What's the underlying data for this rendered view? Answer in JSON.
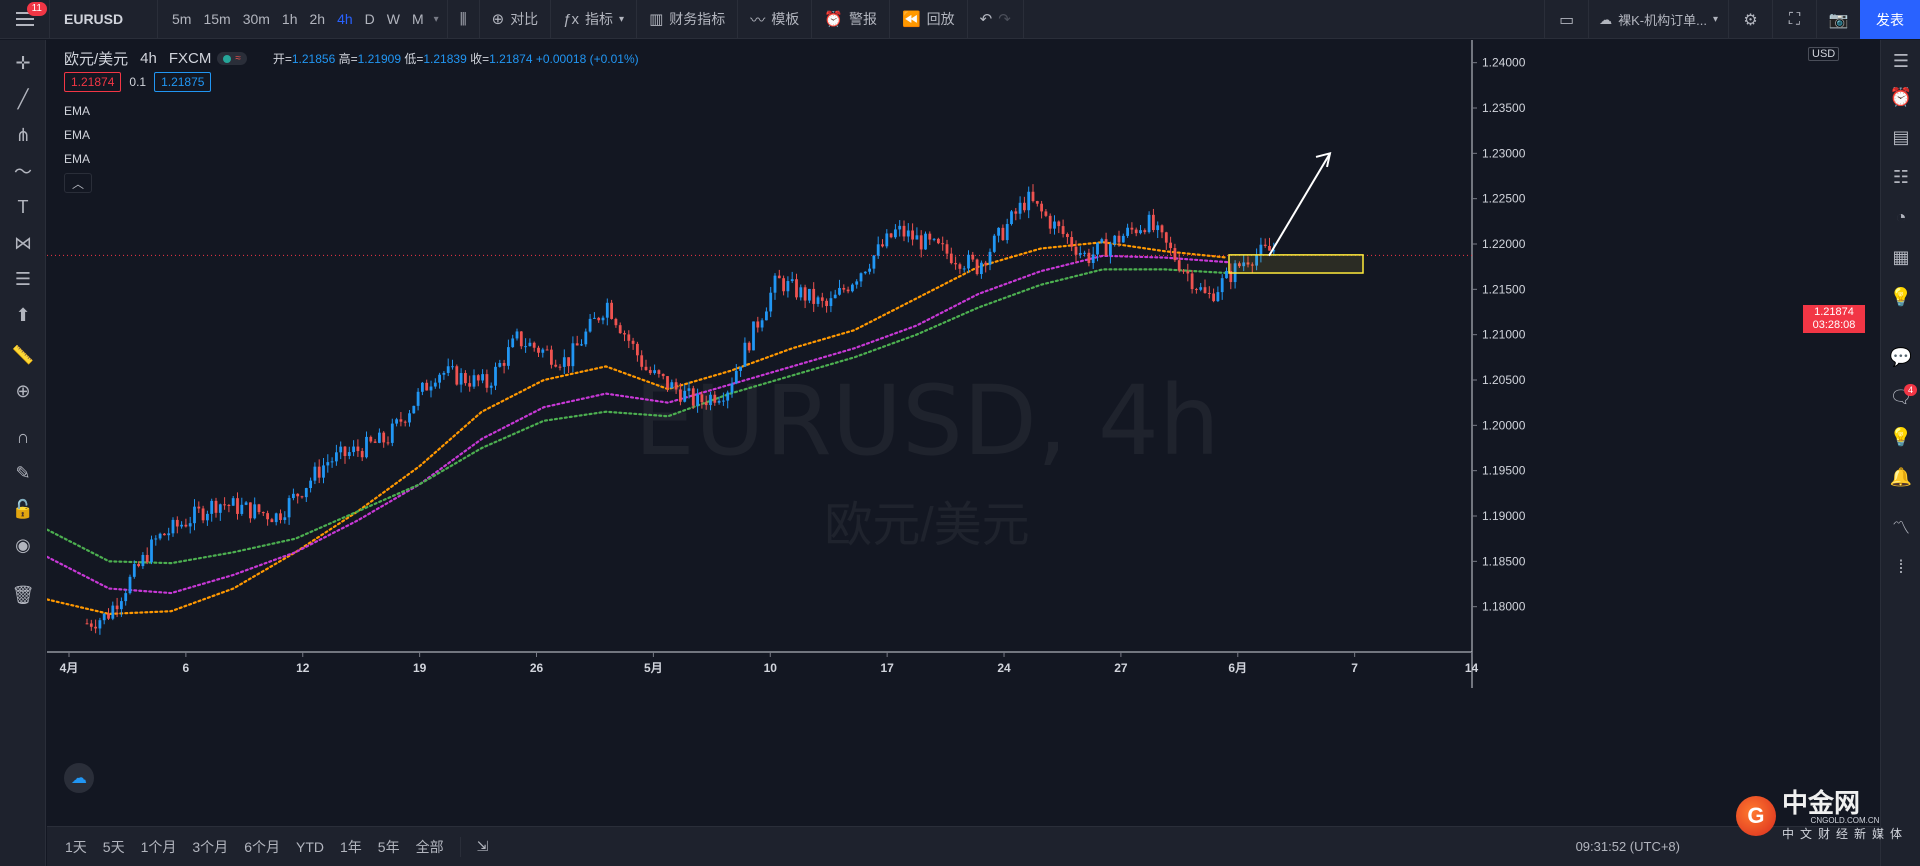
{
  "toolbar": {
    "menu_badge": "11",
    "symbol": "EURUSD",
    "intervals": [
      "5m",
      "15m",
      "30m",
      "1h",
      "2h",
      "4h",
      "D",
      "W",
      "M"
    ],
    "active_interval": "4h",
    "compare": "对比",
    "indicators": "指标",
    "financials": "财务指标",
    "templates": "模板",
    "alert": "警报",
    "replay": "回放",
    "layout_name": "裸K-机构订单...",
    "publish": "发表"
  },
  "legend": {
    "symbol": "欧元/美元",
    "interval": "4h",
    "source": "FXCM",
    "open_label": "开=",
    "open": "1.21856",
    "high_label": "高=",
    "high": "1.21909",
    "low_label": "低=",
    "low": "1.21839",
    "close_label": "收=",
    "close": "1.21874",
    "change": "+0.00018 (+0.01%)",
    "sell": "1.21874",
    "spread": "0.1",
    "buy": "1.21875",
    "indicators": [
      "EMA",
      "EMA",
      "EMA"
    ]
  },
  "watermark": {
    "line1": "EURUSD, 4h",
    "line2": "欧元/美元"
  },
  "price_scale": {
    "currency": "USD",
    "ticks": [
      "1.24000",
      "1.23500",
      "1.23000",
      "1.22500",
      "1.22000",
      "1.21500",
      "1.21000",
      "1.20500",
      "1.20000",
      "1.19500",
      "1.19000",
      "1.18500",
      "1.18000"
    ],
    "last_price": "1.21874",
    "countdown": "03:28:08"
  },
  "time_scale": {
    "ticks": [
      "4月",
      "6",
      "12",
      "19",
      "26",
      "5月",
      "10",
      "17",
      "24",
      "27",
      "6月",
      "7",
      "14"
    ]
  },
  "bottombar": {
    "ranges": [
      "1天",
      "5天",
      "1个月",
      "3个月",
      "6个月",
      "YTD",
      "1年",
      "5年",
      "全部"
    ],
    "clock": "09:31:52 (UTC+8)"
  },
  "brand": {
    "name": "中金网",
    "url": "CNGOLD.COM.CN",
    "tagline": "中文财经新媒体"
  },
  "colors": {
    "up": "#2196f3",
    "down": "#ef5350",
    "ema_fast": "#ff9800",
    "ema_mid": "#c738d6",
    "ema_slow": "#4caf50",
    "zone": "#ffeb3b"
  },
  "chart_data": {
    "type": "candlestick",
    "title": "欧元/美元 · 4h · FXCM",
    "ylim": [
      1.175,
      1.2425
    ],
    "ema_series": [
      {
        "values": [
          1.1808,
          1.1792,
          1.1795,
          1.182,
          1.186,
          1.1905,
          1.1955,
          1.2015,
          1.205,
          1.2065,
          1.204,
          1.206,
          1.2085,
          1.2105,
          1.214,
          1.2175,
          1.2195,
          1.2202,
          1.2192,
          1.2185
        ]
      },
      {
        "values": [
          1.1855,
          1.182,
          1.1815,
          1.1835,
          1.186,
          1.1895,
          1.1935,
          1.1985,
          1.202,
          1.2035,
          1.2025,
          1.2045,
          1.2065,
          1.2085,
          1.211,
          1.2145,
          1.217,
          1.2187,
          1.2185,
          1.218
        ]
      },
      {
        "values": [
          1.1885,
          1.185,
          1.1848,
          1.186,
          1.1875,
          1.1905,
          1.1935,
          1.1975,
          1.2005,
          1.2015,
          1.201,
          1.2035,
          1.2055,
          1.2075,
          1.21,
          1.213,
          1.2155,
          1.2172,
          1.2172,
          1.2168
        ]
      }
    ],
    "ema_x": [
      0,
      50,
      100,
      150,
      200,
      250,
      300,
      350,
      400,
      450,
      500,
      550,
      600,
      650,
      700,
      750,
      800,
      850,
      900,
      950
    ],
    "ema_x_max": 950
  }
}
